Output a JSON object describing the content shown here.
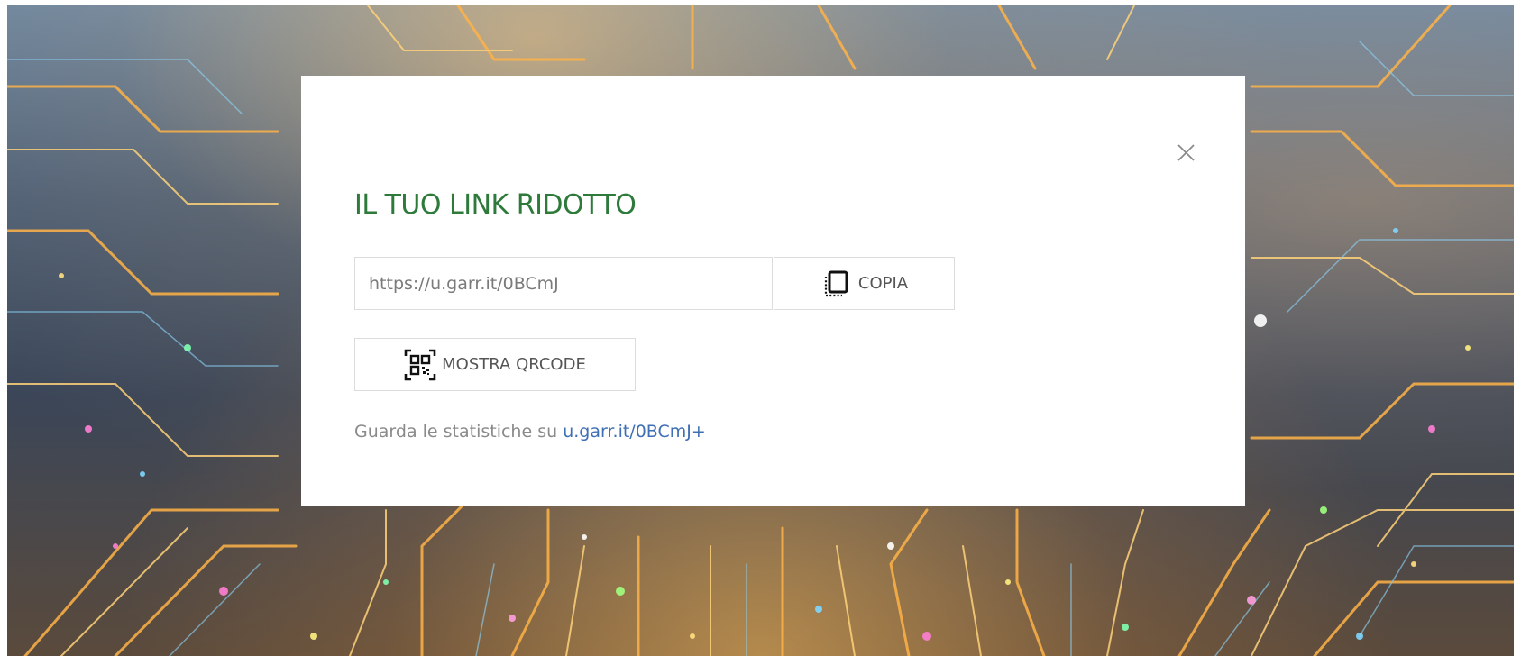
{
  "modal": {
    "title": "IL TUO LINK RIDOTTO",
    "short_link_value": "https://u.garr.it/0BCmJ",
    "copy_label": "COPIA",
    "qr_label": "MOSTRA QRCODE",
    "stats_prefix": "Guarda le statistiche su",
    "stats_link_text": "u.garr.it/0BCmJ+",
    "close_icon": "close-icon",
    "copy_icon": "copy-icon",
    "qr_icon": "qrcode-icon"
  },
  "colors": {
    "title": "#2d7a3a",
    "link": "#3f6fb5",
    "muted_text": "#8a8a8a",
    "border": "#dcdcdc"
  }
}
